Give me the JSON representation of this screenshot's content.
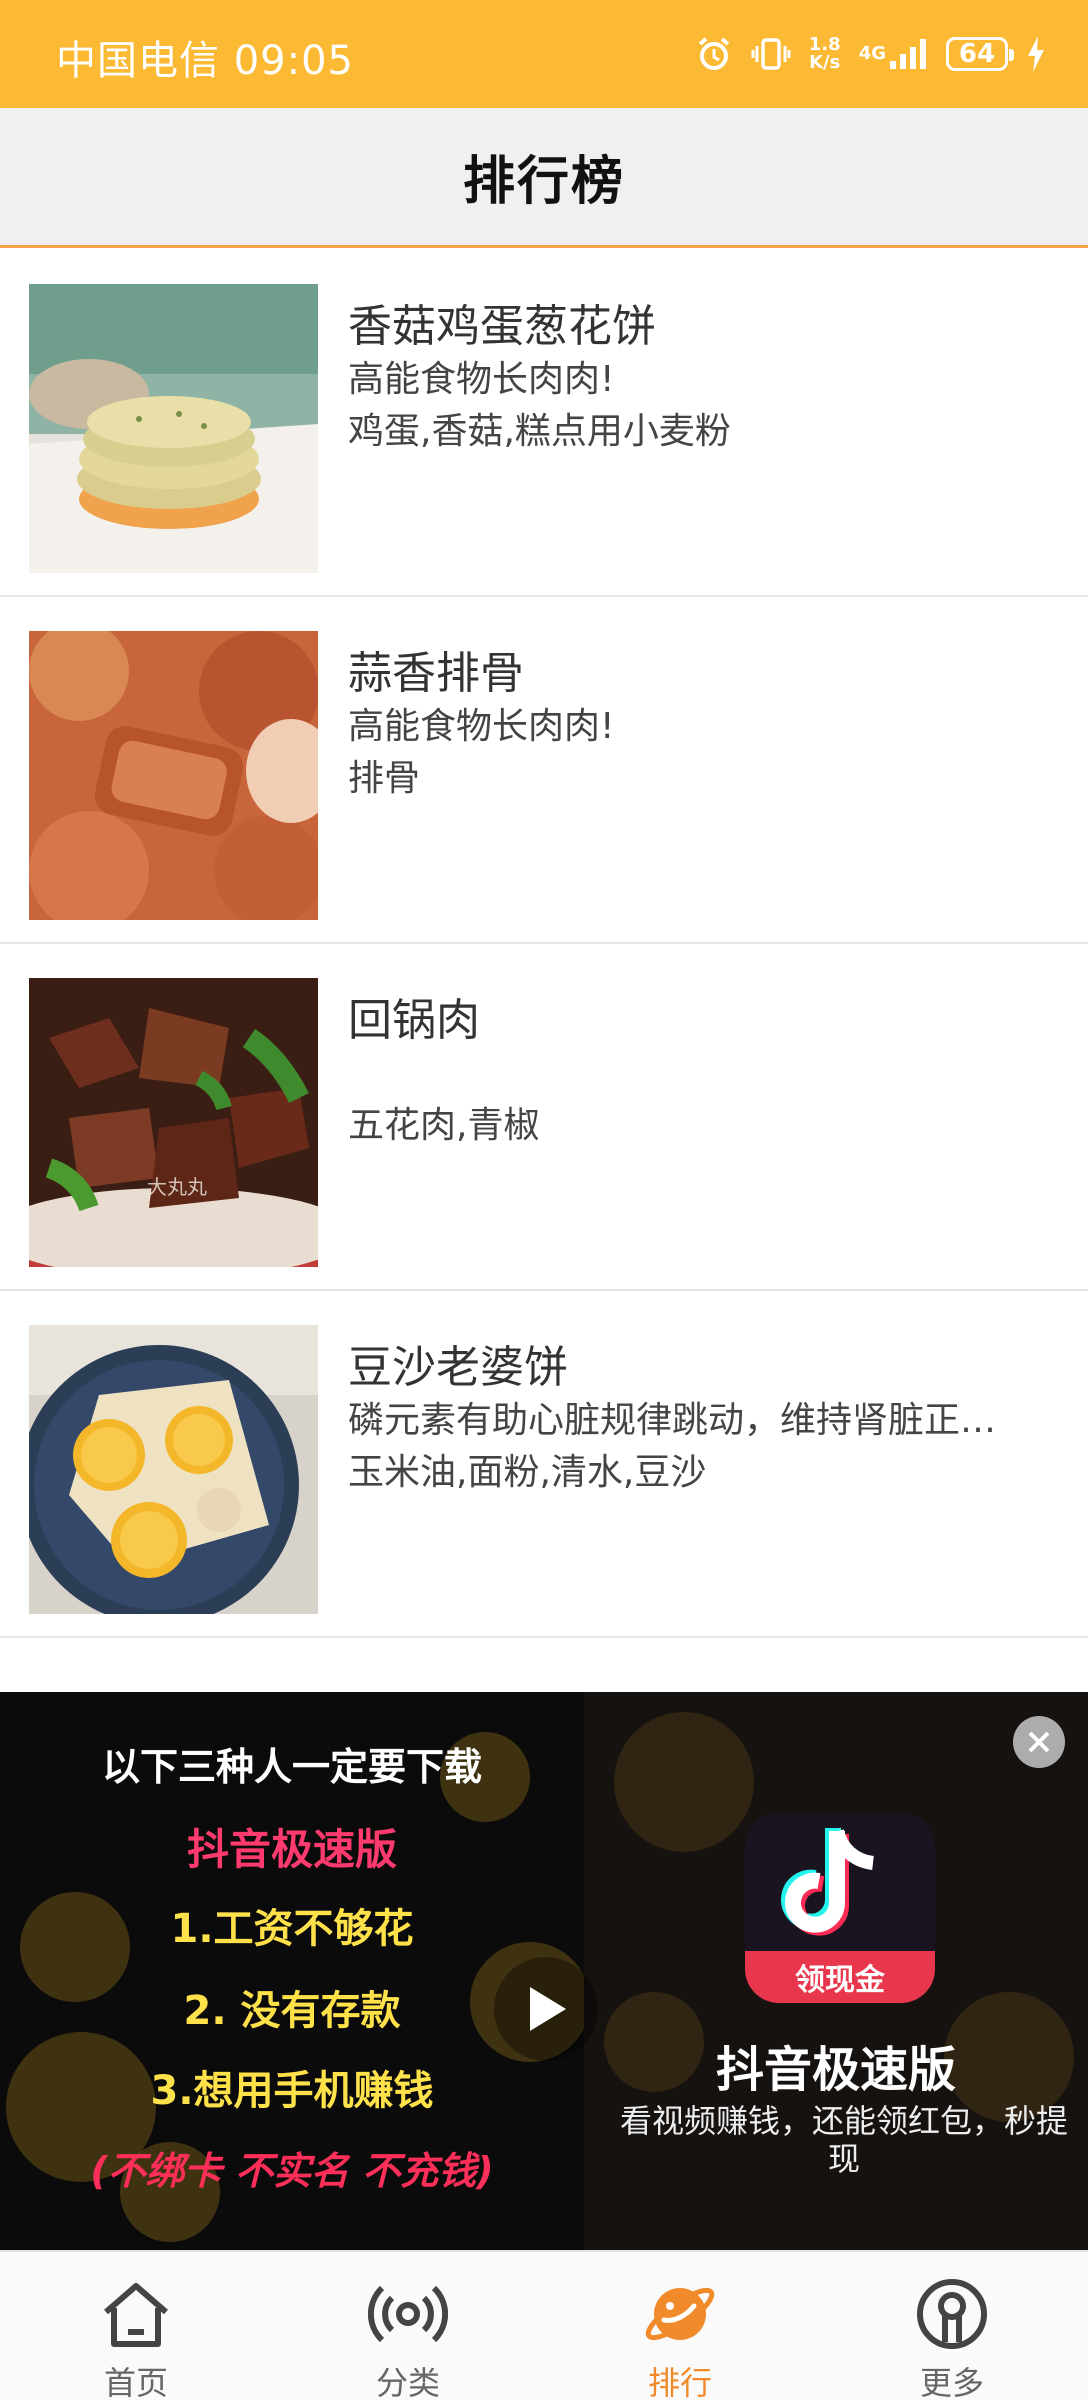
{
  "status_bar": {
    "carrier_time": "中国电信 09:05",
    "network_speed_value": "1.8",
    "network_speed_unit": "K/s",
    "network_type": "4G",
    "battery": "64"
  },
  "header": {
    "title": "排行榜"
  },
  "recipes": [
    {
      "name": "香菇鸡蛋葱花饼",
      "desc": "高能食物长肉肉!",
      "ingredients": "鸡蛋,香菇,糕点用小麦粉"
    },
    {
      "name": "蒜香排骨",
      "desc": "高能食物长肉肉!",
      "ingredients": "排骨"
    },
    {
      "name": "回锅肉",
      "desc": "",
      "ingredients": "五花肉,青椒",
      "watermark": "大丸丸"
    },
    {
      "name": "豆沙老婆饼",
      "desc": "磷元素有助心脏规律跳动，维持肾脏正…",
      "ingredients": "玉米油,面粉,清水,豆沙"
    }
  ],
  "ad": {
    "lines": [
      "以下三种人一定要下载",
      "抖音极速版",
      "1.工资不够花",
      "2. 没有存款",
      "3.想用手机赚钱",
      "(不绑卡 不实名 不充钱)"
    ],
    "app_badge": "领现金",
    "app_name": "抖音极速版",
    "subtitle": "看视频赚钱，还能领红包，秒提现"
  },
  "nav": [
    {
      "label": "首页",
      "icon": "home-icon",
      "active": false
    },
    {
      "label": "分类",
      "icon": "broadcast-icon",
      "active": false
    },
    {
      "label": "排行",
      "icon": "planet-icon",
      "active": true
    },
    {
      "label": "更多",
      "icon": "profile-icon",
      "active": false
    }
  ],
  "colors": {
    "status_bar": "#fbb934",
    "accent": "#f08a2a",
    "header_bg": "#f0f0f0"
  }
}
